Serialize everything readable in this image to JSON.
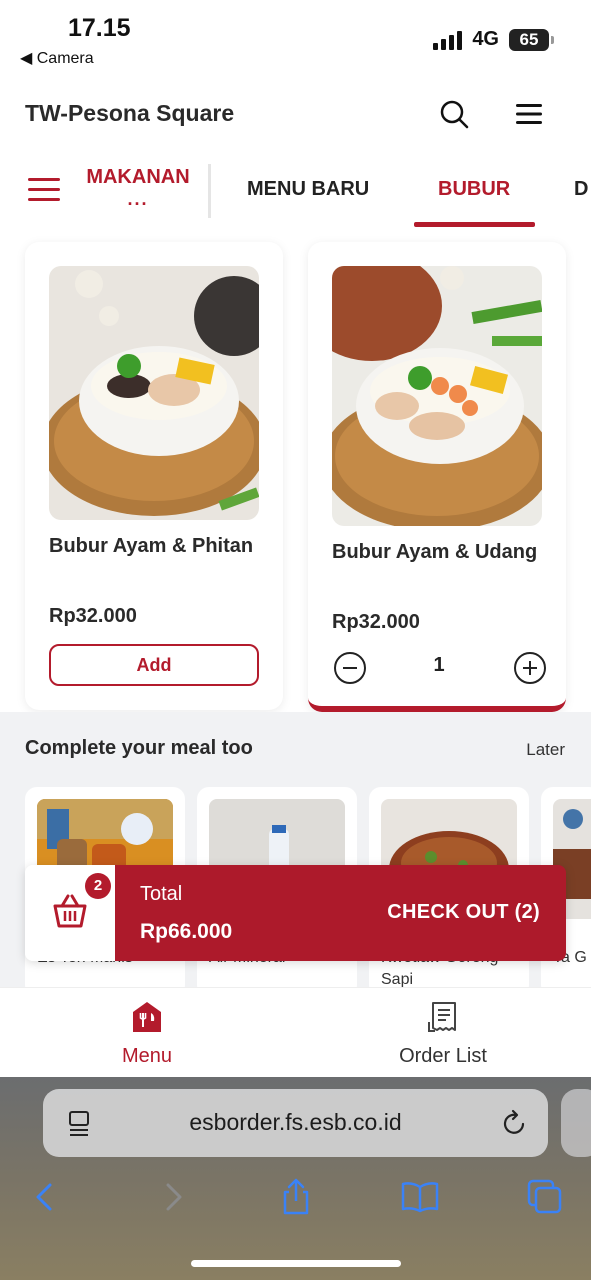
{
  "status_bar": {
    "time": "17.15",
    "back_app": "◀ Camera",
    "network": "4G",
    "battery": "65"
  },
  "header": {
    "title": "TW-Pesona Square",
    "search_icon": "search-icon",
    "menu_icon": "hamburger-icon"
  },
  "categories": {
    "current": "MAKANAN",
    "more": "...",
    "tabs": [
      {
        "label": "MENU BARU"
      },
      {
        "label": "BUBUR",
        "active": true
      },
      {
        "label": "D"
      }
    ]
  },
  "products": [
    {
      "name": "Bubur Ayam & Phitan",
      "price": "Rp32.000",
      "action": "Add"
    },
    {
      "name": "Bubur Ayam & Udang",
      "price": "Rp32.000",
      "quantity": "1"
    }
  ],
  "recommendations": {
    "title": "Complete your meal too",
    "later": "Later",
    "items": [
      {
        "name": "Es Teh Manis"
      },
      {
        "name": "Air Mineral"
      },
      {
        "name": "Kwetiaw Goreng Sapi"
      },
      {
        "name": "Ta G"
      }
    ]
  },
  "checkout": {
    "badge": "2",
    "total_label": "Total",
    "total_value": "Rp66.000",
    "cta": "CHECK OUT (2)"
  },
  "bottom_nav": {
    "menu": "Menu",
    "order_list": "Order List"
  },
  "browser": {
    "url": "esborder.fs.esb.co.id"
  },
  "colors": {
    "brand": "#b31b2c"
  }
}
